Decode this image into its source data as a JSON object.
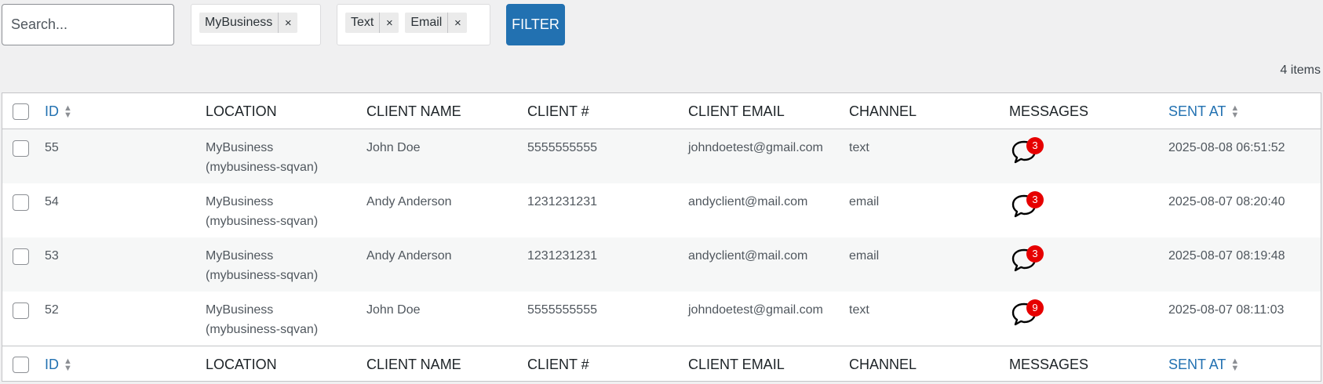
{
  "filters": {
    "search_placeholder": "Search...",
    "search_value": "",
    "location_chips": [
      {
        "label": "MyBusiness",
        "remove": "×"
      }
    ],
    "channel_chips": [
      {
        "label": "Text",
        "remove": "×"
      },
      {
        "label": "Email",
        "remove": "×"
      }
    ],
    "filter_label": "FILTER"
  },
  "item_count": "4 items",
  "columns": {
    "id": "ID",
    "location": "LOCATION",
    "client_name": "CLIENT NAME",
    "client_num": "CLIENT #",
    "client_email": "CLIENT EMAIL",
    "channel": "CHANNEL",
    "messages": "MESSAGES",
    "sent_at": "SENT AT"
  },
  "sort_icons": {
    "up": "▲",
    "down": "▼"
  },
  "rows": [
    {
      "id": "55",
      "location_line1": "MyBusiness",
      "location_line2": "(mybusiness-sqvan)",
      "client_name": "John Doe",
      "client_num": "5555555555",
      "client_email": "johndoetest@gmail.com",
      "channel": "text",
      "messages": "3",
      "sent_at": "2025-08-08 06:51:52"
    },
    {
      "id": "54",
      "location_line1": "MyBusiness",
      "location_line2": "(mybusiness-sqvan)",
      "client_name": "Andy Anderson",
      "client_num": "1231231231",
      "client_email": "andyclient@mail.com",
      "channel": "email",
      "messages": "3",
      "sent_at": "2025-08-07 08:20:40"
    },
    {
      "id": "53",
      "location_line1": "MyBusiness",
      "location_line2": "(mybusiness-sqvan)",
      "client_name": "Andy Anderson",
      "client_num": "1231231231",
      "client_email": "andyclient@mail.com",
      "channel": "email",
      "messages": "3",
      "sent_at": "2025-08-07 08:19:48"
    },
    {
      "id": "52",
      "location_line1": "MyBusiness",
      "location_line2": "(mybusiness-sqvan)",
      "client_name": "John Doe",
      "client_num": "5555555555",
      "client_email": "johndoetest@gmail.com",
      "channel": "text",
      "messages": "9",
      "sent_at": "2025-08-07 08:11:03"
    }
  ],
  "icons": {
    "messages": "chat-bubble-icon",
    "sort": "sort-arrows-icon",
    "remove": "close-icon"
  },
  "colors": {
    "accent": "#2271b1",
    "badge": "#e60000",
    "page_bg": "#f0f0f1",
    "alt_row": "#f6f7f7"
  }
}
